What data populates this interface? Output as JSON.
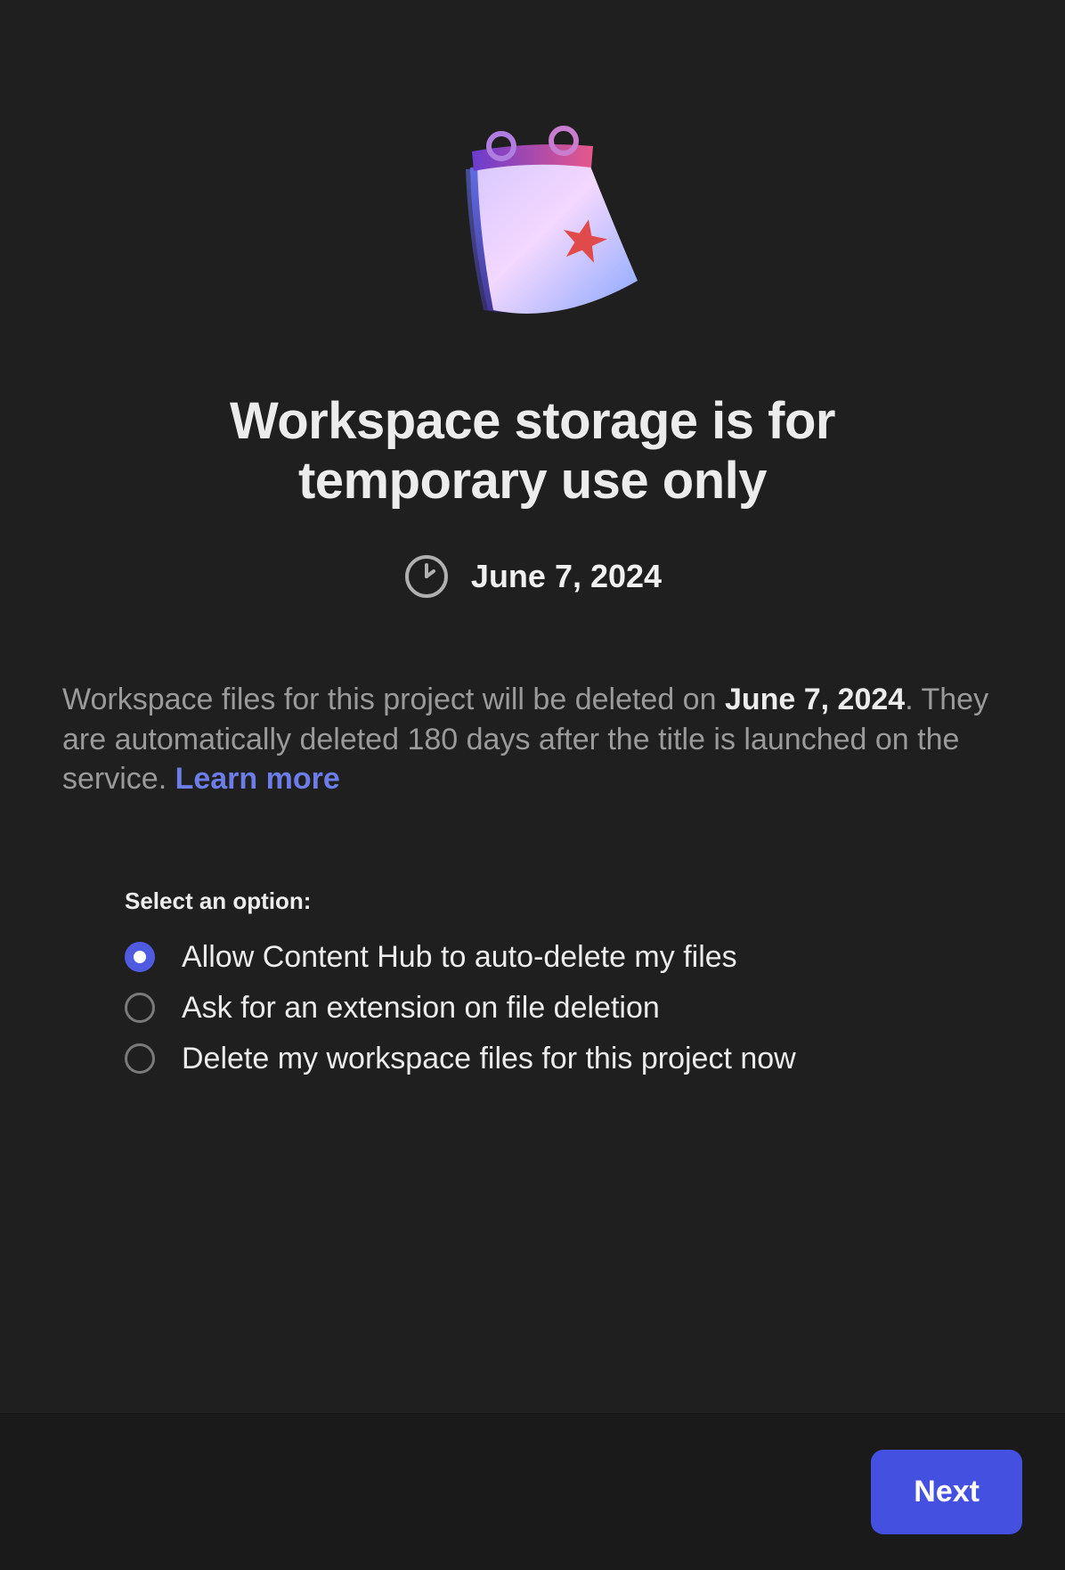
{
  "title": "Workspace storage is for temporary use only",
  "date": "June 7, 2024",
  "description": {
    "prefix": "Workspace files for this project will be deleted on ",
    "bold_date": "June 7, 2024",
    "suffix": ". They are automatically deleted 180 days after the title is launched on the service. ",
    "learn_more": "Learn more"
  },
  "options_label": "Select an option:",
  "options": [
    {
      "label": "Allow Content Hub to auto-delete my files",
      "selected": true
    },
    {
      "label": "Ask for an extension on file deletion",
      "selected": false
    },
    {
      "label": "Delete my workspace files for this project now",
      "selected": false
    }
  ],
  "next_label": "Next"
}
